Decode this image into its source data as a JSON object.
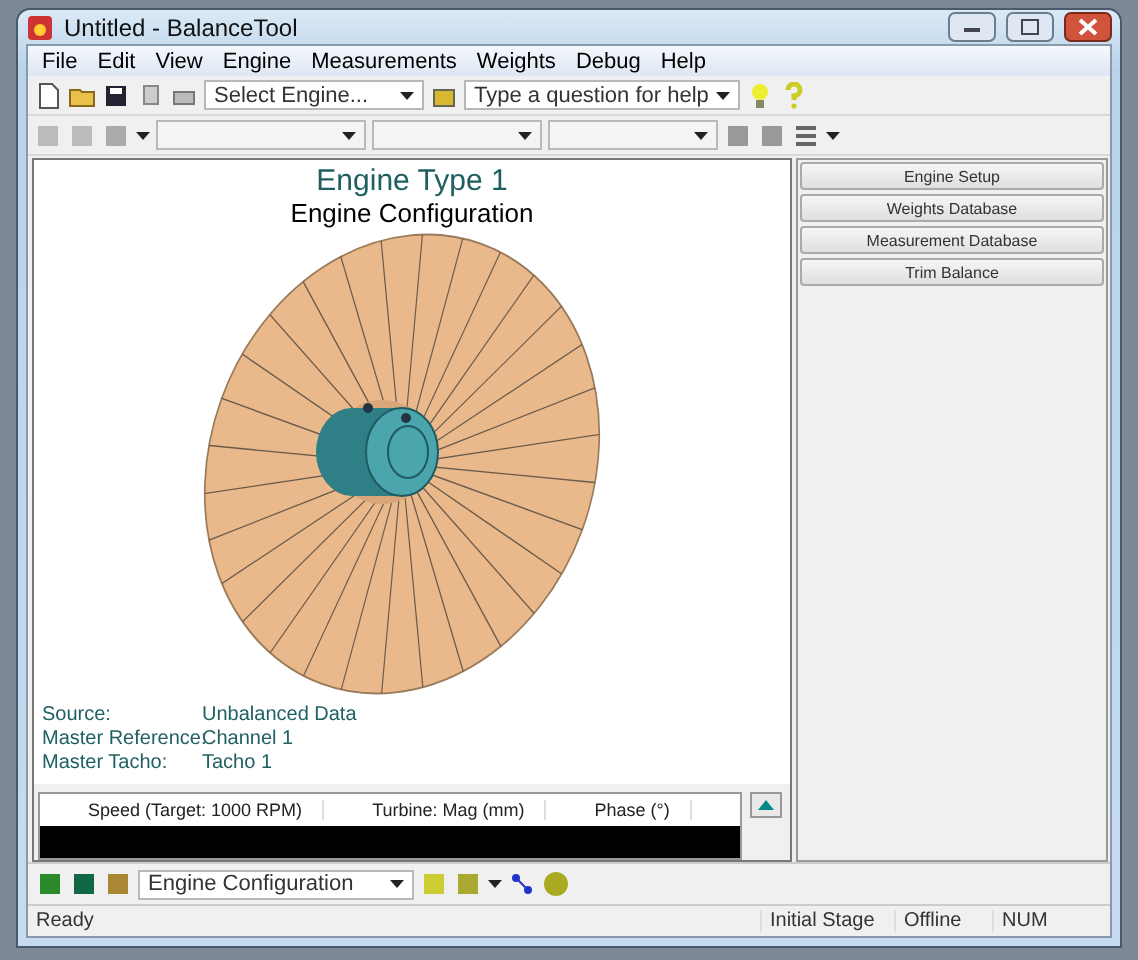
{
  "window": {
    "title": "Untitled - BalanceTool"
  },
  "menu": [
    "File",
    "Edit",
    "View",
    "Engine",
    "Measurements",
    "Weights",
    "Debug",
    "Help"
  ],
  "toolbar": {
    "engine_select": {
      "placeholder": "Select Engine..."
    },
    "help_field": {
      "placeholder": "Type a question for help"
    }
  },
  "view": {
    "title": "Engine Type 1",
    "subtitle": "Engine Configuration",
    "info": [
      {
        "label": "Source:",
        "value": "Unbalanced Data"
      },
      {
        "label": "Master Reference:",
        "value": "Channel 1"
      },
      {
        "label": "Master Tacho:",
        "value": "Tacho 1"
      }
    ]
  },
  "readout": {
    "columns": [
      "Speed (Target: 1000 RPM)",
      "Turbine: Mag (mm)",
      "Phase (°)"
    ]
  },
  "side_buttons": [
    "Engine Setup",
    "Weights Database",
    "Measurement Database",
    "Trim Balance"
  ],
  "bottom_toolbar": {
    "view_select": "Engine Configuration"
  },
  "status_bar": [
    "Ready",
    "Initial Stage",
    "Offline",
    "NUM"
  ]
}
